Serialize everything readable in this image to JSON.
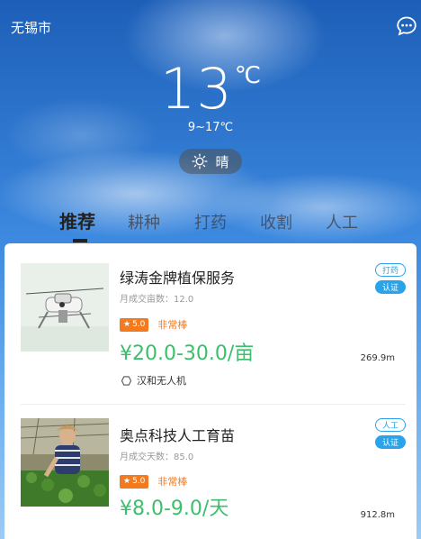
{
  "header": {
    "city": "无锡市",
    "temperature": "13",
    "unit": "℃",
    "range": "9~17℃",
    "condition": "晴",
    "icons": {
      "chat": "chat-bubble-icon",
      "weather": "sun-icon"
    }
  },
  "tabs": [
    {
      "label": "推荐",
      "active": true
    },
    {
      "label": "耕种",
      "active": false
    },
    {
      "label": "打药",
      "active": false
    },
    {
      "label": "收割",
      "active": false
    },
    {
      "label": "人工",
      "active": false
    }
  ],
  "listings": [
    {
      "title": "绿涛金牌植保服务",
      "subtitle": "月成交亩数：12.0",
      "rating": "5.0",
      "rating_text": "非常棒",
      "price": "¥20.0-30.0/亩",
      "distance": "269.9m",
      "tag": "打药",
      "badge": "认证",
      "device": "汉和无人机",
      "image": "drone-photo"
    },
    {
      "title": "奥点科技人工育苗",
      "subtitle": "月成交天数：85.0",
      "rating": "5.0",
      "rating_text": "非常棒",
      "price": "¥8.0-9.0/天",
      "distance": "912.8m",
      "tag": "人工",
      "badge": "认证",
      "image": "greenhouse-worker-photo"
    }
  ],
  "colors": {
    "accent_green": "#3cbf6b",
    "accent_orange": "#f47a1f",
    "accent_blue": "#2aa3e8"
  }
}
